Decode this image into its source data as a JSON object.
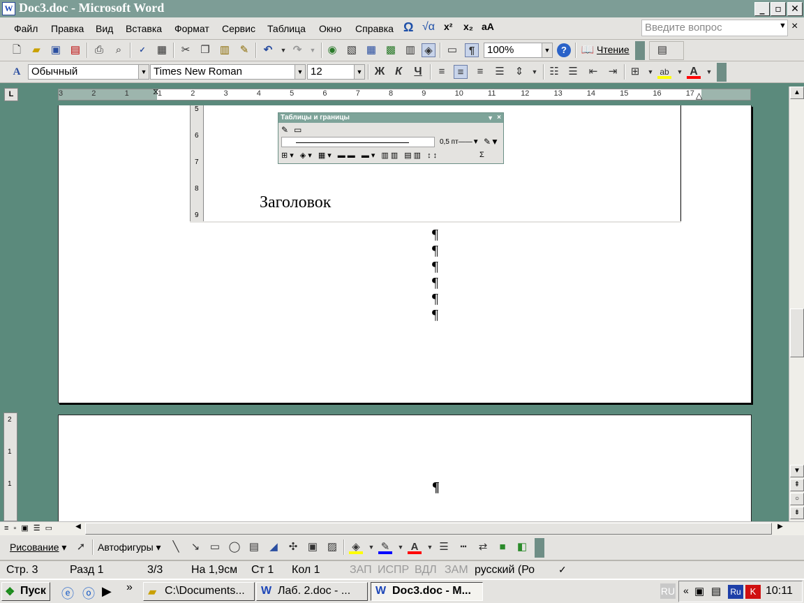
{
  "window": {
    "title": "Doc3.doc - Microsoft Word",
    "icon": "word-icon",
    "buttons": [
      "_",
      "▫",
      "✕"
    ]
  },
  "menubar": {
    "items": [
      "Файл",
      "Правка",
      "Вид",
      "Вставка",
      "Формат",
      "Сервис",
      "Таблица",
      "Окно",
      "Справка"
    ],
    "extra_icons": [
      "Ω",
      "√α",
      "x²",
      "x₂",
      "aA"
    ],
    "ask_placeholder": "Введите вопрос",
    "close": "×"
  },
  "standard_toolbar": {
    "zoom": "100%",
    "reading_label": "Чтение",
    "icons": [
      "new-icon",
      "open-icon",
      "save-icon",
      "permission-icon",
      "print-icon",
      "preview-icon",
      "spelling-icon",
      "research-icon",
      "cut-icon",
      "copy-icon",
      "paste-icon",
      "format-painter-icon",
      "undo-icon",
      "redo-icon",
      "hyperlink-icon",
      "tables-borders-icon",
      "insert-table-icon",
      "insert-excel-icon",
      "columns-icon",
      "drawing-icon",
      "document-map-icon",
      "pilcrow-icon"
    ]
  },
  "formatting_toolbar": {
    "style": "Обычный",
    "font": "Times New Roman",
    "size": "12",
    "bold": "Ж",
    "italic": "К",
    "underline": "Ч",
    "highlight_color": "#ffff00",
    "font_color": "#ff0000"
  },
  "ruler": {
    "numbers": [
      "3",
      "2",
      "1",
      "1",
      "2",
      "3",
      "4",
      "5",
      "6",
      "7",
      "8",
      "9",
      "10",
      "11",
      "12",
      "13",
      "14",
      "15",
      "16",
      "17"
    ]
  },
  "vertical_ruler": {
    "numbers": [
      "5",
      "6",
      "7",
      "8",
      "9"
    ],
    "bottom_numbers": [
      "2",
      "1",
      "1"
    ]
  },
  "tables_borders_toolbar": {
    "title": "Таблицы и границы",
    "line_weight": "0,5 пт",
    "sum": "Σ"
  },
  "document": {
    "heading": "Заголовок",
    "pilcrow": "¶",
    "pilcrow_count_page1": 6
  },
  "drawing_toolbar": {
    "draw_label": "Рисование",
    "autoshapes_label": "Автофигуры",
    "fill_color": "#ffff00",
    "line_color": "#0000ff",
    "font_color": "#ff0000"
  },
  "statusbar": {
    "page": "Стр. 3",
    "section": "Разд 1",
    "pages": "3/3",
    "at": "На 1,9см",
    "line": "Ст 1",
    "column": "Кол 1",
    "rec": "ЗАП",
    "trk": "ИСПР",
    "ext": "ВДЛ",
    "ovr": "ЗАМ",
    "language": "русский (Ро"
  },
  "taskbar": {
    "start": "Пуск",
    "more": "»",
    "tasks": [
      "C:\\Documents...",
      "Лаб. 2.doc - ...",
      "Doc3.doc - M..."
    ],
    "lang": "RU",
    "tray_lang": "Ru",
    "time": "10:11"
  }
}
